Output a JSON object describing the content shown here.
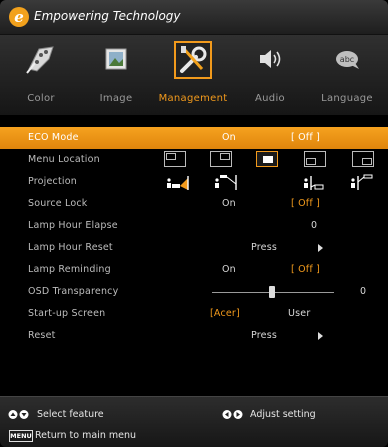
{
  "header": {
    "brand_letter": "e",
    "brand_text": "Empowering Technology"
  },
  "tabs": [
    {
      "label": "Color",
      "icon": "color-palette-icon",
      "active": false
    },
    {
      "label": "Image",
      "icon": "image-icon",
      "active": false
    },
    {
      "label": "Management",
      "icon": "wrench-screwdriver-icon",
      "active": true
    },
    {
      "label": "Audio",
      "icon": "speaker-icon",
      "active": false
    },
    {
      "label": "Language",
      "icon": "language-globe-icon",
      "active": false
    }
  ],
  "menu": {
    "eco_mode": {
      "label": "ECO Mode",
      "opt1": "On",
      "opt2": "[ Off ]"
    },
    "menu_location": {
      "label": "Menu Location",
      "selected_index": 2
    },
    "projection": {
      "label": "Projection"
    },
    "source_lock": {
      "label": "Source Lock",
      "opt1": "On",
      "opt2": "[ Off ]"
    },
    "lamp_hour_elapse": {
      "label": "Lamp Hour Elapse",
      "value": "0"
    },
    "lamp_hour_reset": {
      "label": "Lamp Hour Reset",
      "action": "Press"
    },
    "lamp_reminding": {
      "label": "Lamp Reminding",
      "opt1": "On",
      "opt2": "[ Off ]"
    },
    "osd_transparency": {
      "label": "OSD Transparency",
      "value": "0"
    },
    "startup_screen": {
      "label": "Start-up Screen",
      "opt1": "[Acer]",
      "opt2": "User"
    },
    "reset": {
      "label": "Reset",
      "action": "Press"
    }
  },
  "footer": {
    "select_feature": "Select feature",
    "adjust_setting": "Adjust setting",
    "menu_key": "MENU",
    "return": "Return to main menu"
  },
  "colors": {
    "accent": "#f29a1c",
    "selected_row": "#f6a21f",
    "background": "#000000"
  }
}
